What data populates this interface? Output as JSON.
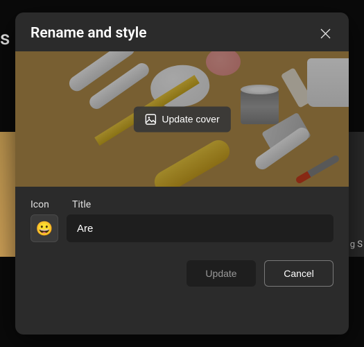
{
  "backdrop": {
    "partial_text": "es",
    "right_label": "g S"
  },
  "modal": {
    "title": "Rename and style",
    "cover": {
      "update_label": "Update cover"
    },
    "form": {
      "icon_label": "Icon",
      "title_label": "Title",
      "icon_value": "😀",
      "title_value": "Are"
    },
    "actions": {
      "update": "Update",
      "cancel": "Cancel"
    }
  }
}
